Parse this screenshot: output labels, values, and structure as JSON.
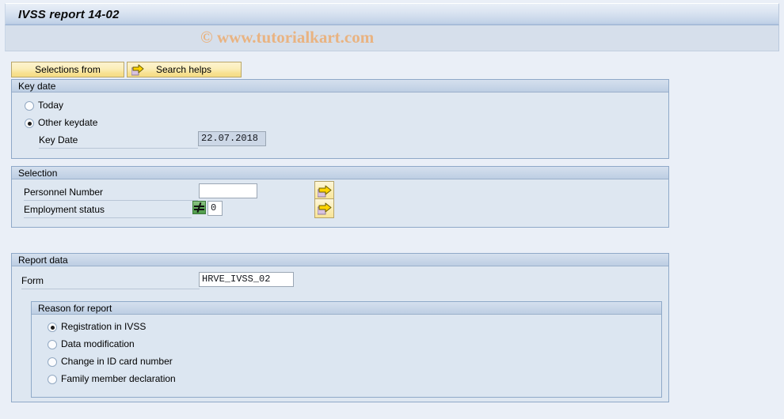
{
  "window": {
    "title": "IVSS report 14-02",
    "watermark": "© www.tutorialkart.com"
  },
  "toolbar": {
    "buttons": [
      {
        "label": "Selections from",
        "icon": null
      },
      {
        "label": "Search helps",
        "icon": "arrow-right-icon"
      }
    ]
  },
  "key_date_group": {
    "title": "Key date",
    "options": [
      {
        "label": "Today",
        "selected": false
      },
      {
        "label": "Other keydate",
        "selected": true
      }
    ],
    "key_date_field": {
      "label": "Key Date",
      "value": "22.07.2018"
    }
  },
  "selection_group": {
    "title": "Selection",
    "rows": [
      {
        "label": "Personnel Number",
        "value": "",
        "operator": null,
        "multi_select_icon": "arrow-right-icon"
      },
      {
        "label": "Employment status",
        "value": "0",
        "operator": "≠",
        "operator_icon": "not-equal-icon",
        "multi_select_icon": "arrow-right-icon"
      }
    ]
  },
  "report_data_group": {
    "title": "Report data",
    "form_label": "Form",
    "form_value": "HRVE_IVSS_02",
    "reason_group": {
      "title": "Reason for report",
      "options": [
        {
          "label": "Registration in IVSS",
          "selected": true
        },
        {
          "label": "Data modification",
          "selected": false
        },
        {
          "label": "Change in ID card number",
          "selected": false
        },
        {
          "label": "Family member declaration",
          "selected": false
        }
      ]
    }
  },
  "colors": {
    "window_bg": "#eaeff7",
    "titlebar_accent": "#b5c8e0",
    "group_bg": "#dee7f1",
    "button_yellow": "#f7e192",
    "watermark": "#e9b381",
    "operator_green": "#63ad5d"
  }
}
